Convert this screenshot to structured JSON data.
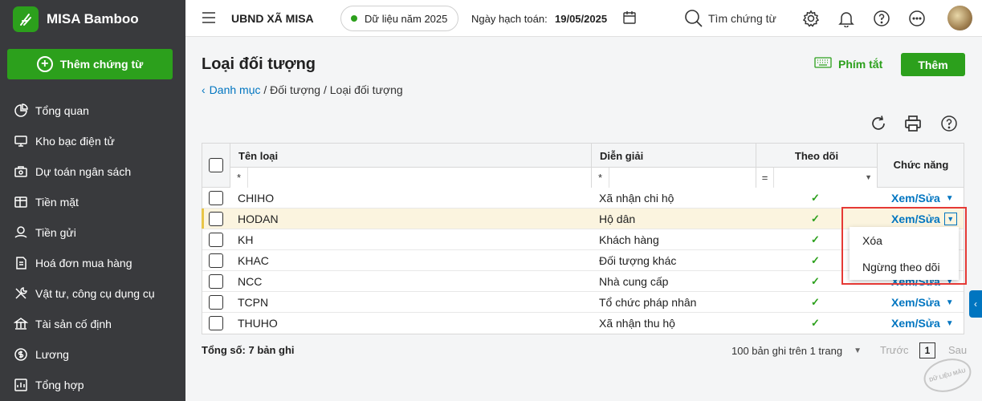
{
  "brand": {
    "name": "MISA Bamboo"
  },
  "sidebar": {
    "add_label": "Thêm chứng từ",
    "items": [
      {
        "label": "Tổng quan",
        "icon": "pie-chart-icon"
      },
      {
        "label": "Kho bạc điện tử",
        "icon": "monitor-icon"
      },
      {
        "label": "Dự toán ngân sách",
        "icon": "budget-icon"
      },
      {
        "label": "Tiền mặt",
        "icon": "cash-icon"
      },
      {
        "label": "Tiền gửi",
        "icon": "deposit-icon"
      },
      {
        "label": "Hoá đơn mua hàng",
        "icon": "invoice-icon"
      },
      {
        "label": "Vật tư, công cụ dụng cụ",
        "icon": "tools-icon"
      },
      {
        "label": "Tài sản cố định",
        "icon": "building-icon"
      },
      {
        "label": "Lương",
        "icon": "salary-icon"
      },
      {
        "label": "Tổng hợp",
        "icon": "summary-icon"
      }
    ]
  },
  "header": {
    "org_name": "UBND XÃ MISA",
    "data_year": "Dữ liệu năm 2025",
    "date_label": "Ngày hạch toán:",
    "date_value": "19/05/2025",
    "search_label": "Tìm chứng từ"
  },
  "page": {
    "title": "Loại đối tượng",
    "shortcut_label": "Phím tắt",
    "add_label": "Thêm",
    "breadcrumb": {
      "root": "Danh mục",
      "separator1": " / ",
      "middle": "Đối tượng",
      "separator2": " / ",
      "current": "Loại đối tượng"
    }
  },
  "table": {
    "headers": {
      "name": "Tên loại",
      "description": "Diễn giải",
      "tracking": "Theo dõi",
      "action": "Chức năng"
    },
    "filters": {
      "name_op": "*",
      "description_op": "*",
      "tracking_op": "="
    },
    "action_label": "Xem/Sửa",
    "rows": [
      {
        "name": "CHIHO",
        "description": "Xã nhận chi hộ",
        "tracked": true
      },
      {
        "name": "HODAN",
        "description": "Hộ dân",
        "tracked": true,
        "highlighted": true
      },
      {
        "name": "KH",
        "description": "Khách hàng",
        "tracked": true
      },
      {
        "name": "KHAC",
        "description": "Đối tượng khác",
        "tracked": true
      },
      {
        "name": "NCC",
        "description": "Nhà cung cấp",
        "tracked": true
      },
      {
        "name": "TCPN",
        "description": "Tổ chức pháp nhân",
        "tracked": true
      },
      {
        "name": "THUHO",
        "description": "Xã nhận thu hộ",
        "tracked": true
      }
    ]
  },
  "dropdown_menu": {
    "items": [
      "Xóa",
      "Ngừng theo dõi"
    ]
  },
  "footer": {
    "total": "Tổng số: 7 bản ghi",
    "per_page": "100 bản ghi trên 1 trang",
    "prev": "Trước",
    "page": "1",
    "next": "Sau"
  },
  "watermark": {
    "text": "DỮ LIỆU MẪU"
  },
  "colors": {
    "accent_green": "#2ca01c",
    "link_blue": "#0075c0",
    "sidebar_bg": "#393a3d",
    "highlight_row": "#fbf4df",
    "callout_red": "#e53935"
  }
}
